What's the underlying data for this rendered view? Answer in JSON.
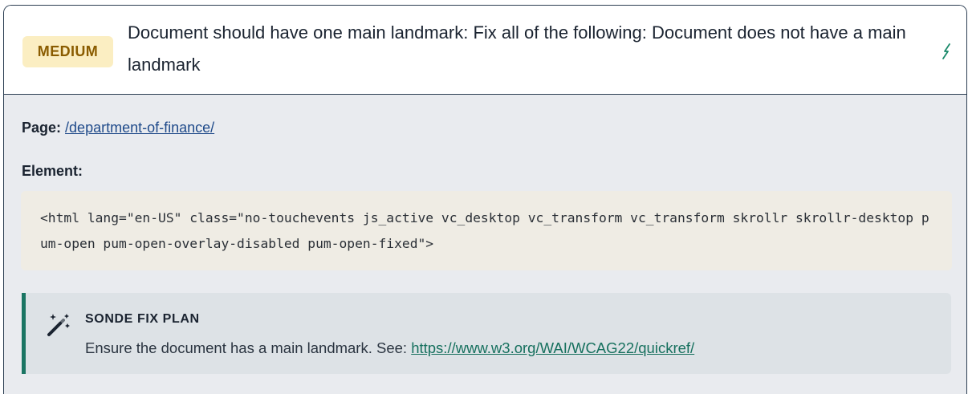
{
  "issue": {
    "severity": "MEDIUM",
    "title": "Document should have one main landmark: Fix all of the following: Document does not have a main landmark",
    "severity_color": "#8a5c00",
    "severity_bg": "#fbeec2",
    "action_icon": "lightning-icon"
  },
  "details": {
    "page_label": "Page:",
    "page_url": "/department-of-finance/",
    "element_label": "Element:",
    "element_code": "<html lang=\"en-US\" class=\"no-touchevents js_active vc_desktop vc_transform vc_transform skrollr skrollr-desktop pum-open pum-open-overlay-disabled pum-open-fixed\">"
  },
  "fix_plan": {
    "icon": "magic-wand-icon",
    "title": "SONDE FIX PLAN",
    "text_prefix": "Ensure the document has a main landmark. See: ",
    "link": "https://www.w3.org/WAI/WCAG22/quickref/",
    "accent_color": "#1a7563"
  }
}
